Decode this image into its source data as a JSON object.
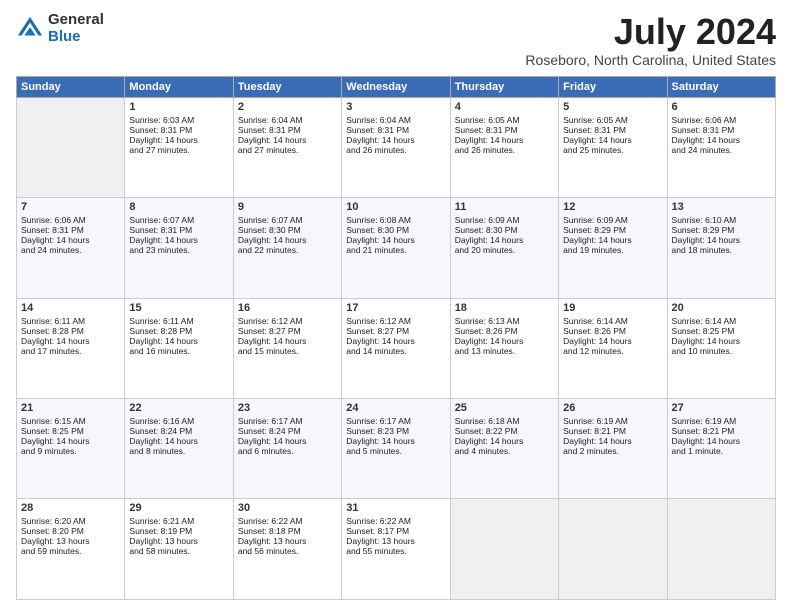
{
  "logo": {
    "general": "General",
    "blue": "Blue"
  },
  "title": "July 2024",
  "location": "Roseboro, North Carolina, United States",
  "days_header": [
    "Sunday",
    "Monday",
    "Tuesday",
    "Wednesday",
    "Thursday",
    "Friday",
    "Saturday"
  ],
  "weeks": [
    [
      {
        "num": "",
        "content": ""
      },
      {
        "num": "1",
        "content": "Sunrise: 6:03 AM\nSunset: 8:31 PM\nDaylight: 14 hours\nand 27 minutes."
      },
      {
        "num": "2",
        "content": "Sunrise: 6:04 AM\nSunset: 8:31 PM\nDaylight: 14 hours\nand 27 minutes."
      },
      {
        "num": "3",
        "content": "Sunrise: 6:04 AM\nSunset: 8:31 PM\nDaylight: 14 hours\nand 26 minutes."
      },
      {
        "num": "4",
        "content": "Sunrise: 6:05 AM\nSunset: 8:31 PM\nDaylight: 14 hours\nand 26 minutes."
      },
      {
        "num": "5",
        "content": "Sunrise: 6:05 AM\nSunset: 8:31 PM\nDaylight: 14 hours\nand 25 minutes."
      },
      {
        "num": "6",
        "content": "Sunrise: 6:06 AM\nSunset: 8:31 PM\nDaylight: 14 hours\nand 24 minutes."
      }
    ],
    [
      {
        "num": "7",
        "content": "Sunrise: 6:06 AM\nSunset: 8:31 PM\nDaylight: 14 hours\nand 24 minutes."
      },
      {
        "num": "8",
        "content": "Sunrise: 6:07 AM\nSunset: 8:31 PM\nDaylight: 14 hours\nand 23 minutes."
      },
      {
        "num": "9",
        "content": "Sunrise: 6:07 AM\nSunset: 8:30 PM\nDaylight: 14 hours\nand 22 minutes."
      },
      {
        "num": "10",
        "content": "Sunrise: 6:08 AM\nSunset: 8:30 PM\nDaylight: 14 hours\nand 21 minutes."
      },
      {
        "num": "11",
        "content": "Sunrise: 6:09 AM\nSunset: 8:30 PM\nDaylight: 14 hours\nand 20 minutes."
      },
      {
        "num": "12",
        "content": "Sunrise: 6:09 AM\nSunset: 8:29 PM\nDaylight: 14 hours\nand 19 minutes."
      },
      {
        "num": "13",
        "content": "Sunrise: 6:10 AM\nSunset: 8:29 PM\nDaylight: 14 hours\nand 18 minutes."
      }
    ],
    [
      {
        "num": "14",
        "content": "Sunrise: 6:11 AM\nSunset: 8:28 PM\nDaylight: 14 hours\nand 17 minutes."
      },
      {
        "num": "15",
        "content": "Sunrise: 6:11 AM\nSunset: 8:28 PM\nDaylight: 14 hours\nand 16 minutes."
      },
      {
        "num": "16",
        "content": "Sunrise: 6:12 AM\nSunset: 8:27 PM\nDaylight: 14 hours\nand 15 minutes."
      },
      {
        "num": "17",
        "content": "Sunrise: 6:12 AM\nSunset: 8:27 PM\nDaylight: 14 hours\nand 14 minutes."
      },
      {
        "num": "18",
        "content": "Sunrise: 6:13 AM\nSunset: 8:26 PM\nDaylight: 14 hours\nand 13 minutes."
      },
      {
        "num": "19",
        "content": "Sunrise: 6:14 AM\nSunset: 8:26 PM\nDaylight: 14 hours\nand 12 minutes."
      },
      {
        "num": "20",
        "content": "Sunrise: 6:14 AM\nSunset: 8:25 PM\nDaylight: 14 hours\nand 10 minutes."
      }
    ],
    [
      {
        "num": "21",
        "content": "Sunrise: 6:15 AM\nSunset: 8:25 PM\nDaylight: 14 hours\nand 9 minutes."
      },
      {
        "num": "22",
        "content": "Sunrise: 6:16 AM\nSunset: 8:24 PM\nDaylight: 14 hours\nand 8 minutes."
      },
      {
        "num": "23",
        "content": "Sunrise: 6:17 AM\nSunset: 8:24 PM\nDaylight: 14 hours\nand 6 minutes."
      },
      {
        "num": "24",
        "content": "Sunrise: 6:17 AM\nSunset: 8:23 PM\nDaylight: 14 hours\nand 5 minutes."
      },
      {
        "num": "25",
        "content": "Sunrise: 6:18 AM\nSunset: 8:22 PM\nDaylight: 14 hours\nand 4 minutes."
      },
      {
        "num": "26",
        "content": "Sunrise: 6:19 AM\nSunset: 8:21 PM\nDaylight: 14 hours\nand 2 minutes."
      },
      {
        "num": "27",
        "content": "Sunrise: 6:19 AM\nSunset: 8:21 PM\nDaylight: 14 hours\nand 1 minute."
      }
    ],
    [
      {
        "num": "28",
        "content": "Sunrise: 6:20 AM\nSunset: 8:20 PM\nDaylight: 13 hours\nand 59 minutes."
      },
      {
        "num": "29",
        "content": "Sunrise: 6:21 AM\nSunset: 8:19 PM\nDaylight: 13 hours\nand 58 minutes."
      },
      {
        "num": "30",
        "content": "Sunrise: 6:22 AM\nSunset: 8:18 PM\nDaylight: 13 hours\nand 56 minutes."
      },
      {
        "num": "31",
        "content": "Sunrise: 6:22 AM\nSunset: 8:17 PM\nDaylight: 13 hours\nand 55 minutes."
      },
      {
        "num": "",
        "content": ""
      },
      {
        "num": "",
        "content": ""
      },
      {
        "num": "",
        "content": ""
      }
    ]
  ]
}
